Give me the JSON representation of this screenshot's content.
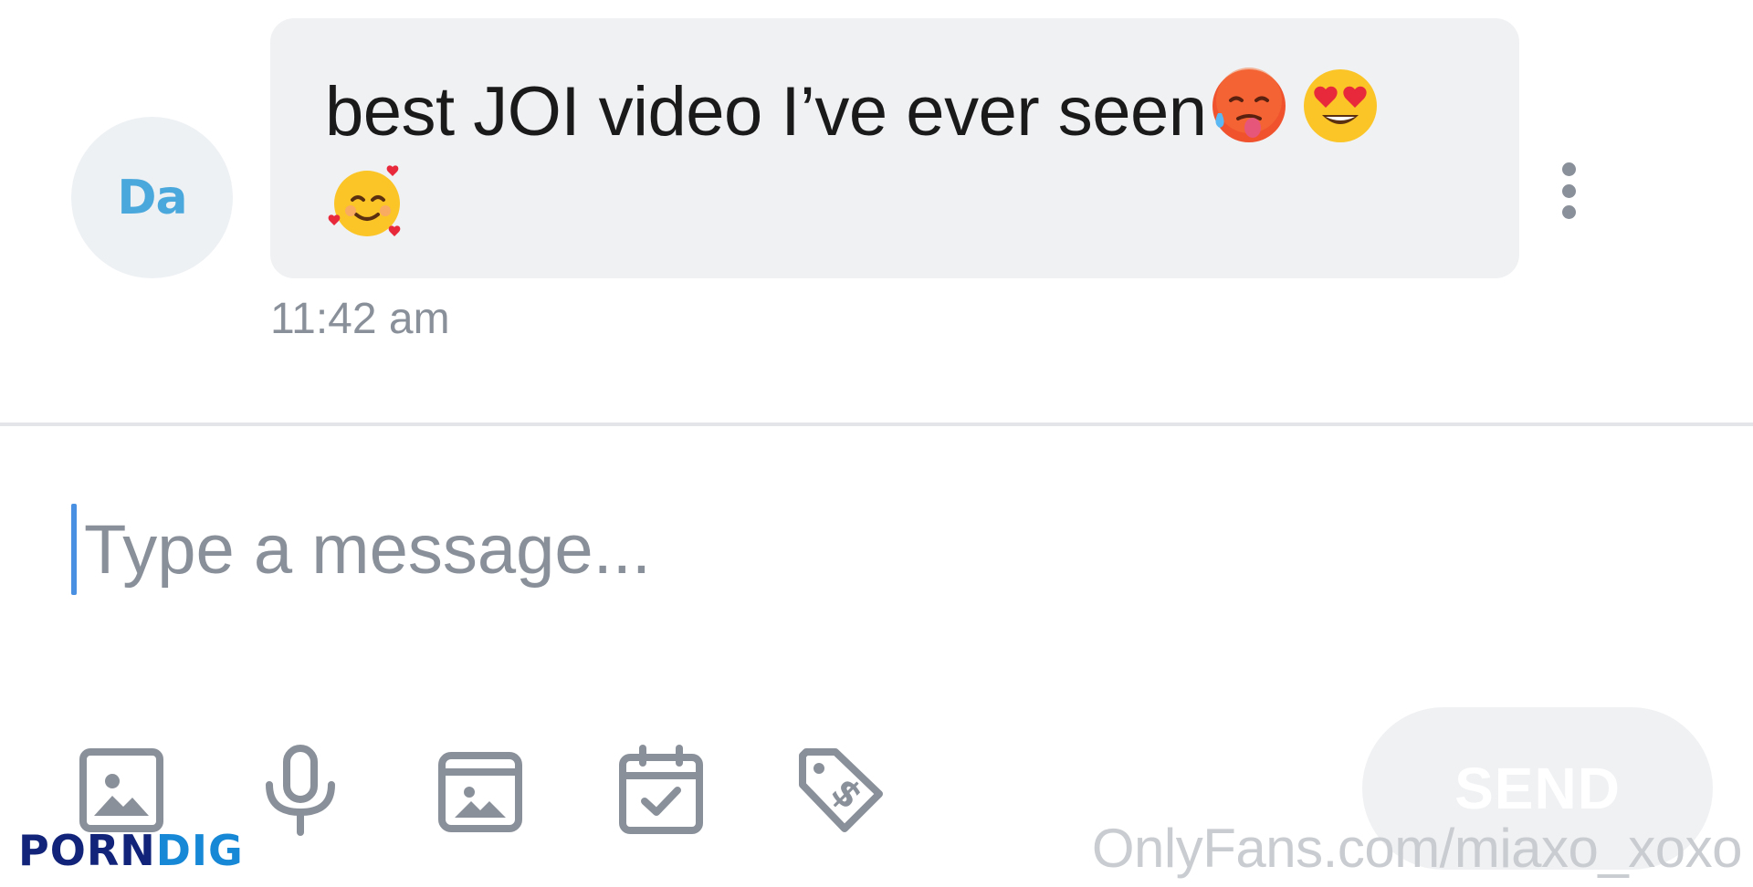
{
  "message": {
    "avatar_initials": "Da",
    "text": "best JOI video I’ve ever seen",
    "emojis": [
      "hot-face-emoji",
      "heart-eyes-emoji",
      "smiling-face-with-hearts-emoji"
    ],
    "timestamp": "11:42 am"
  },
  "composer": {
    "placeholder": "Type a message...",
    "value": "",
    "send_label": "SEND",
    "tools": [
      "image-icon",
      "microphone-icon",
      "gallery-icon",
      "calendar-check-icon",
      "price-tag-icon"
    ]
  },
  "watermarks": {
    "left_part1": "PORN",
    "left_part2": "DIG",
    "right": "OnlyFans.com/miaxo_xoxo"
  },
  "colors": {
    "bubble": "#f0f1f3",
    "avatar_text": "#4aa8dc",
    "icon": "#8a9099",
    "caret": "#4a90e2"
  }
}
